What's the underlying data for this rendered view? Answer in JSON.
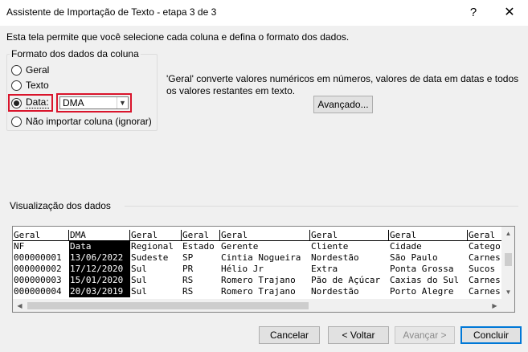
{
  "window": {
    "title": "Assistente de Importação de Texto - etapa 3 de 3",
    "help_glyph": "?",
    "close_glyph": "✕"
  },
  "description": "Esta tela permite que você selecione cada coluna e defina o formato dos dados.",
  "format_group": {
    "legend": "Formato dos dados da coluna",
    "options": [
      {
        "label": "Geral",
        "checked": false
      },
      {
        "label": "Texto",
        "checked": false
      },
      {
        "label": "Data:",
        "checked": true
      },
      {
        "label": "Não importar coluna (ignorar)",
        "checked": false
      }
    ],
    "date_format": "DMA"
  },
  "info_text": "'Geral' converte valores numéricos em números, valores de data em datas e todos os valores restantes em texto.",
  "advanced_button": "Avançado...",
  "preview": {
    "label": "Visualização dos dados",
    "headers": [
      "Geral",
      "DMA",
      "Geral",
      "Geral",
      "Geral",
      "Geral",
      "Geral",
      "Geral"
    ],
    "rows": [
      [
        "NF",
        "Data",
        "Regional",
        "Estado",
        "Gerente",
        "Cliente",
        "Cidade",
        "Catego"
      ],
      [
        "000000001",
        "13/06/2022",
        "Sudeste",
        "SP",
        "Cintia Nogueira",
        "Nordestão",
        "São Paulo",
        "Carnes"
      ],
      [
        "000000002",
        "17/12/2020",
        "Sul",
        "PR",
        "Hélio Jr",
        "Extra",
        "Ponta Grossa",
        "Sucos"
      ],
      [
        "000000003",
        "15/01/2020",
        "Sul",
        "RS",
        "Romero Trajano",
        "Pão de Açúcar",
        "Caxias do Sul",
        "Carnes"
      ],
      [
        "000000004",
        "20/03/2019",
        "Sul",
        "RS",
        "Romero Trajano",
        "Nordestão",
        "Porto Alegre",
        "Carnes"
      ]
    ],
    "selected_column": 1
  },
  "buttons": {
    "cancel": "Cancelar",
    "back": "< Voltar",
    "next": "Avançar >",
    "finish": "Concluir"
  }
}
